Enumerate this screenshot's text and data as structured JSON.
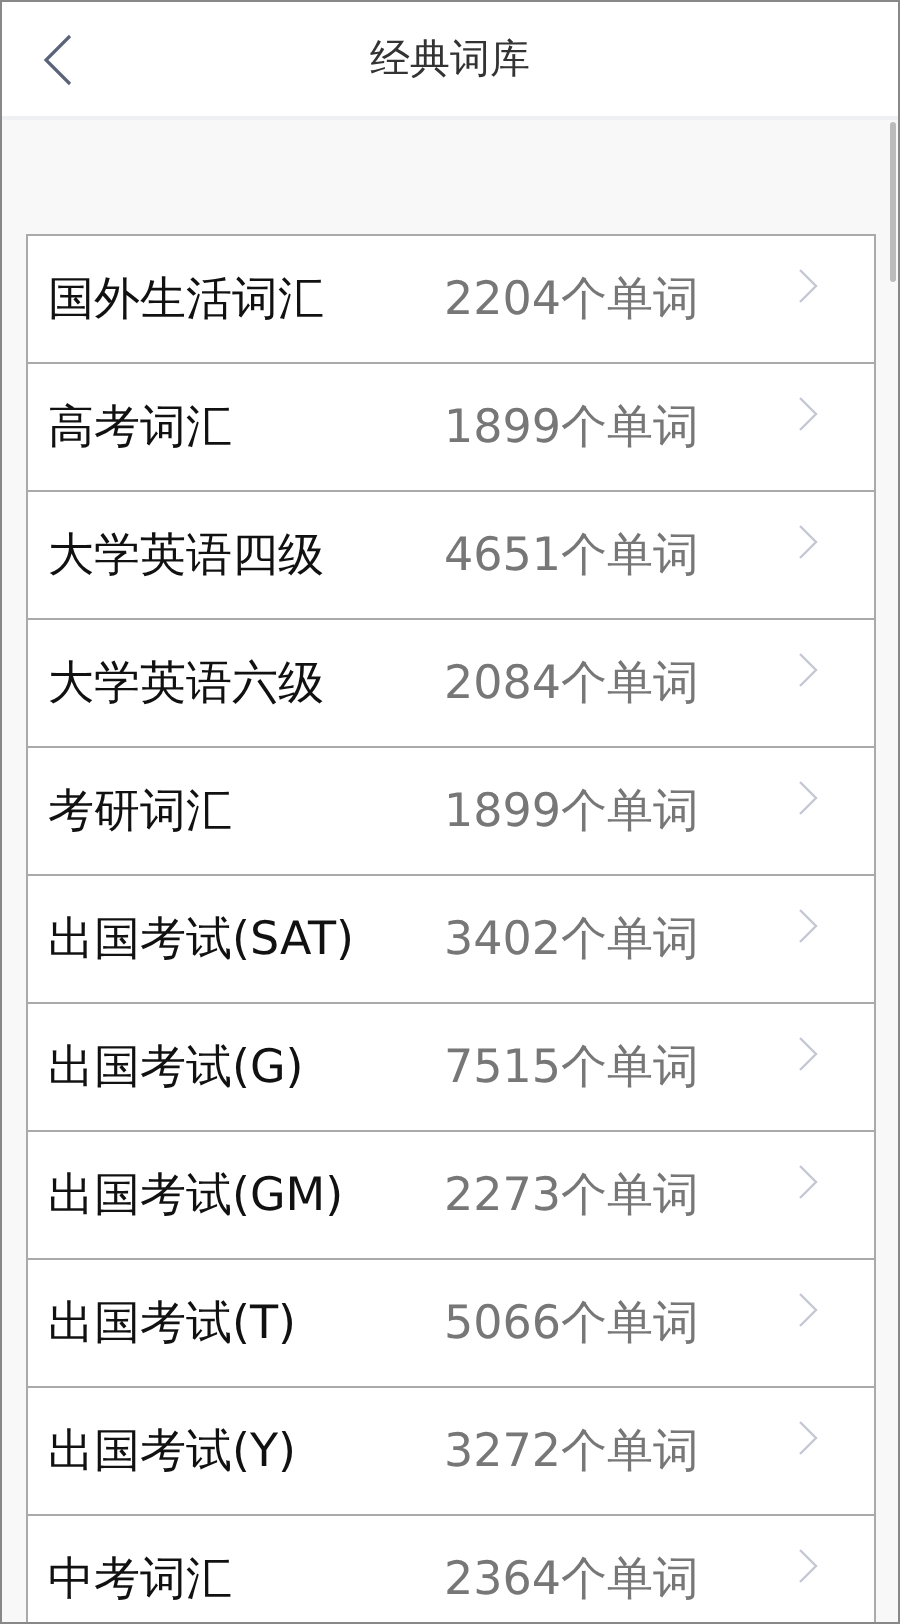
{
  "header": {
    "title": "经典词库"
  },
  "items": [
    {
      "name": "国外生活词汇",
      "count": "2204个单词"
    },
    {
      "name": "高考词汇",
      "count": "1899个单词"
    },
    {
      "name": "大学英语四级",
      "count": "4651个单词"
    },
    {
      "name": "大学英语六级",
      "count": "2084个单词"
    },
    {
      "name": "考研词汇",
      "count": "1899个单词"
    },
    {
      "name": "出国考试(SAT)",
      "count": "3402个单词"
    },
    {
      "name": "出国考试(G)",
      "count": "7515个单词"
    },
    {
      "name": "出国考试(GM)",
      "count": "2273个单词"
    },
    {
      "name": "出国考试(T)",
      "count": "5066个单词"
    },
    {
      "name": "出国考试(Y)",
      "count": "3272个单词"
    },
    {
      "name": "中考词汇",
      "count": "2364个单词"
    }
  ]
}
